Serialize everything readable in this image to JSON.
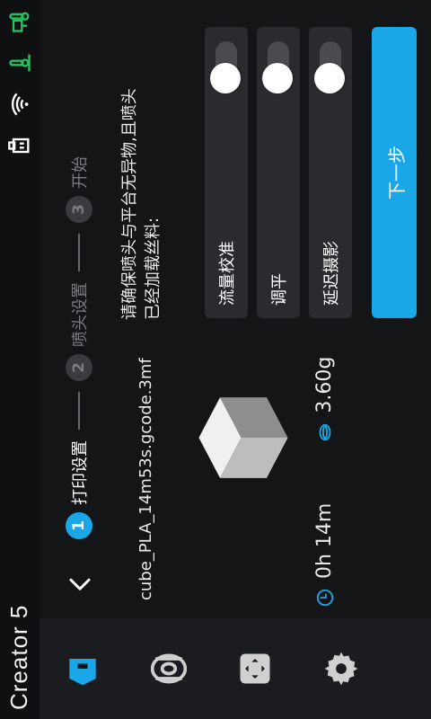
{
  "colors": {
    "accent": "#1aa7e8",
    "background": "#141517",
    "panel": "#2a2b2e",
    "sidebar": "#1b1c1f",
    "green_status": "#22c55e"
  },
  "brand": {
    "title": "Creator 5"
  },
  "status_icons": [
    "usb-icon",
    "wifi-icon",
    "bed-thermometer-icon",
    "nozzle-thermometer-icon"
  ],
  "nav": {
    "items": [
      {
        "name": "print-tag-icon",
        "active": true
      },
      {
        "name": "filament-spool-icon",
        "active": false
      },
      {
        "name": "move-control-icon",
        "active": false
      },
      {
        "name": "settings-gear-icon",
        "active": false
      }
    ]
  },
  "stepper": {
    "back_icon": "chevron-left-icon",
    "steps": [
      {
        "number": "1",
        "label": "打印设置",
        "active": true
      },
      {
        "number": "2",
        "label": "喷头设置",
        "active": false
      },
      {
        "number": "3",
        "label": "开始",
        "active": false
      }
    ]
  },
  "file": {
    "name": "cube_PLA_14m53s.gcode.3mf",
    "time": "0h 14m",
    "weight": "3.60g",
    "time_icon": "clock-icon",
    "weight_icon": "filament-coil-icon"
  },
  "instruction": "请确保喷头与平台无异物,且喷头已经加载丝料:",
  "options": [
    {
      "label": "流量校准",
      "enabled": false
    },
    {
      "label": "调平",
      "enabled": false
    },
    {
      "label": "延迟摄影",
      "enabled": false
    }
  ],
  "next_button": {
    "label": "下一步"
  }
}
